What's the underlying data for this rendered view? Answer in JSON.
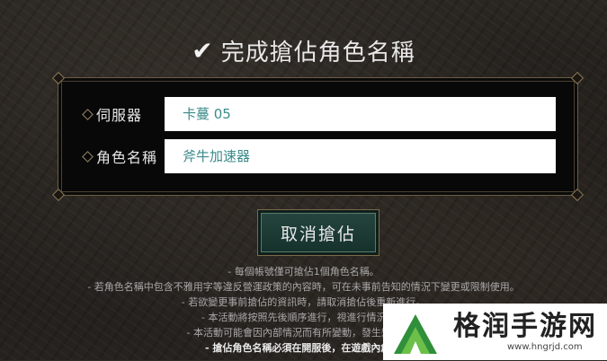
{
  "title": "完成搶佔角色名稱",
  "form": {
    "server_label": "伺服器",
    "server_value": "卡蔓 05",
    "character_label": "角色名稱",
    "character_value": "斧牛加速器"
  },
  "button": {
    "cancel_label": "取消搶佔"
  },
  "notes": [
    "- 每個帳號僅可搶佔1個角色名稱。",
    "- 若角色名稱中包含不雅用字等違反營運政策的內容時，可在未事前告知的情況下變更或限制使用。",
    "- 若欲變更事前搶佔的資訊時，請取消搶佔後重新進行。",
    "- 本活動將按照先後順序進行，視進行情況可...",
    "- 本活動可能會因內部情況而有所變動，發生變動時...",
    "- 搶佔角色名稱必須在開服後，在遊戲內創..."
  ],
  "watermark": {
    "name": "格润手游网",
    "url": "www.hngrjd.com"
  },
  "colors": {
    "accent_teal": "#274640",
    "field_text": "#3a8a8a",
    "border_gold": "#6a5c44"
  }
}
